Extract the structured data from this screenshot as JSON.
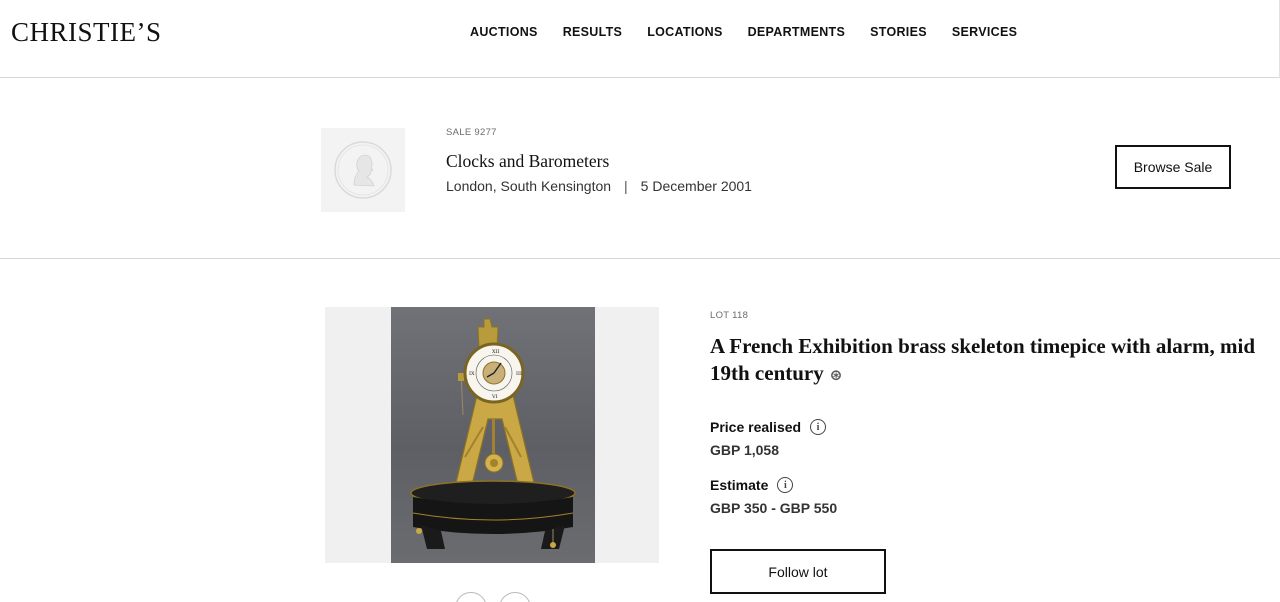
{
  "brand": {
    "logo_text": "CHRISTIE’S"
  },
  "nav": [
    {
      "label": "AUCTIONS"
    },
    {
      "label": "RESULTS"
    },
    {
      "label": "LOCATIONS"
    },
    {
      "label": "DEPARTMENTS"
    },
    {
      "label": "STORIES"
    },
    {
      "label": "SERVICES"
    }
  ],
  "sale": {
    "number_label": "SALE 9277",
    "title": "Clocks and Barometers",
    "location": "London, South Kensington",
    "separator": "|",
    "date": "5 December 2001",
    "browse_label": "Browse Sale",
    "thumb_icon": "portrait-medallion-icon"
  },
  "lot": {
    "number_label": "LOT 118",
    "title": "A French Exhibition brass skeleton timepice with alarm, mid 19th century",
    "title_symbol": "⊛",
    "price_realised_label": "Price realised",
    "price_realised_value": "GBP 1,058",
    "estimate_label": "Estimate",
    "estimate_value": "GBP 350 - GBP 550",
    "info_icon_glyph": "i",
    "follow_label": "Follow lot"
  },
  "colors": {
    "text": "#111111",
    "muted": "#6b6b6b",
    "divider": "#d8d8d8",
    "image_bg": "#f0f0f0"
  }
}
